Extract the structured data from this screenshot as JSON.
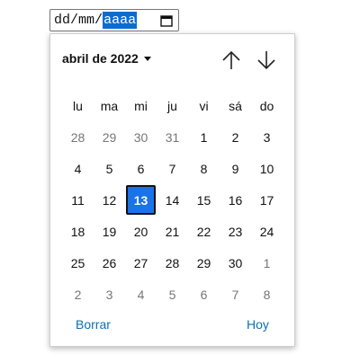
{
  "input": {
    "day_placeholder": "dd",
    "month_placeholder": "mm",
    "year_placeholder": "aaaa",
    "separator": "/"
  },
  "popup": {
    "month_year_label": "abril de 2022",
    "weekdays": [
      "lu",
      "ma",
      "mi",
      "ju",
      "vi",
      "sá",
      "do"
    ],
    "weeks": [
      [
        {
          "d": "28",
          "out": true
        },
        {
          "d": "29",
          "out": true
        },
        {
          "d": "30",
          "out": true
        },
        {
          "d": "31",
          "out": true
        },
        {
          "d": "1"
        },
        {
          "d": "2"
        },
        {
          "d": "3"
        }
      ],
      [
        {
          "d": "4"
        },
        {
          "d": "5"
        },
        {
          "d": "6"
        },
        {
          "d": "7"
        },
        {
          "d": "8"
        },
        {
          "d": "9"
        },
        {
          "d": "10"
        }
      ],
      [
        {
          "d": "11"
        },
        {
          "d": "12"
        },
        {
          "d": "13",
          "today": true
        },
        {
          "d": "14"
        },
        {
          "d": "15"
        },
        {
          "d": "16"
        },
        {
          "d": "17"
        }
      ],
      [
        {
          "d": "18"
        },
        {
          "d": "19"
        },
        {
          "d": "20"
        },
        {
          "d": "21"
        },
        {
          "d": "22"
        },
        {
          "d": "23"
        },
        {
          "d": "24"
        }
      ],
      [
        {
          "d": "25"
        },
        {
          "d": "26"
        },
        {
          "d": "27"
        },
        {
          "d": "28"
        },
        {
          "d": "29"
        },
        {
          "d": "30"
        },
        {
          "d": "1",
          "out": true
        }
      ],
      [
        {
          "d": "2",
          "out": true
        },
        {
          "d": "3",
          "out": true
        },
        {
          "d": "4",
          "out": true
        },
        {
          "d": "5",
          "out": true
        },
        {
          "d": "6",
          "out": true
        },
        {
          "d": "7",
          "out": true
        },
        {
          "d": "8",
          "out": true
        }
      ]
    ],
    "clear_label": "Borrar",
    "today_label": "Hoy"
  },
  "icons": {
    "calendar": "calendar-icon",
    "caret": "caret-down-icon",
    "prev": "arrow-up-icon",
    "next": "arrow-down-icon"
  },
  "colors": {
    "selection": "#0a6cd1",
    "today_bg": "#1a73e8",
    "link": "#0b6fb8",
    "muted": "#767676"
  }
}
